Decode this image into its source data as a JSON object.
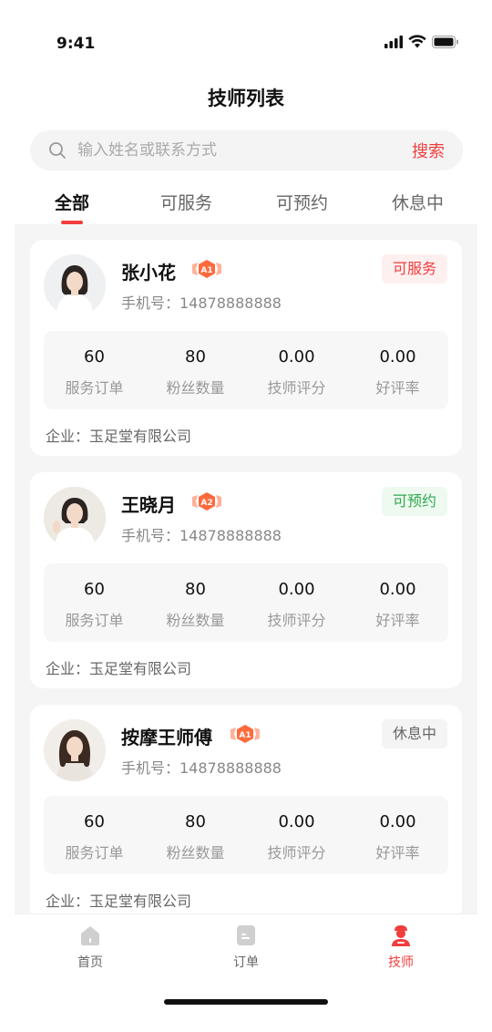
{
  "status_bar": {
    "time": "9:41"
  },
  "header": {
    "title": "技师列表"
  },
  "search": {
    "placeholder": "输入姓名或联系方式",
    "button_label": "搜索"
  },
  "tabs": [
    {
      "label": "全部",
      "active": true
    },
    {
      "label": "可服务",
      "active": false
    },
    {
      "label": "可预约",
      "active": false
    },
    {
      "label": "休息中",
      "active": false
    }
  ],
  "technicians": [
    {
      "name": "张小花",
      "level": "A1",
      "phone": "手机号：14878888888",
      "status": "可服务",
      "status_color": "#f23d3d",
      "status_bg": "#fff0f0",
      "stats": [
        {
          "value": "60",
          "label": "服务订单"
        },
        {
          "value": "80",
          "label": "粉丝数量"
        },
        {
          "value": "0.00",
          "label": "技师评分"
        },
        {
          "value": "0.00",
          "label": "好评率"
        }
      ],
      "company": "企业：玉足堂有限公司"
    },
    {
      "name": "王晓月",
      "level": "A2",
      "phone": "手机号：14878888888",
      "status": "可预约",
      "status_color": "#2fa84f",
      "status_bg": "#eefaf0",
      "stats": [
        {
          "value": "60",
          "label": "服务订单"
        },
        {
          "value": "80",
          "label": "粉丝数量"
        },
        {
          "value": "0.00",
          "label": "技师评分"
        },
        {
          "value": "0.00",
          "label": "好评率"
        }
      ],
      "company": "企业：玉足堂有限公司"
    },
    {
      "name": "按摩王师傅",
      "level": "A1",
      "phone": "手机号：14878888888",
      "status": "休息中",
      "status_color": "#666666",
      "status_bg": "#f4f4f4",
      "stats": [
        {
          "value": "60",
          "label": "服务订单"
        },
        {
          "value": "80",
          "label": "粉丝数量"
        },
        {
          "value": "0.00",
          "label": "技师评分"
        },
        {
          "value": "0.00",
          "label": "好评率"
        }
      ],
      "company": "企业：玉足堂有限公司"
    }
  ],
  "tabbar": [
    {
      "label": "首页",
      "icon": "home-icon",
      "active": false
    },
    {
      "label": "订单",
      "icon": "order-icon",
      "active": false
    },
    {
      "label": "技师",
      "icon": "technician-icon",
      "active": true
    }
  ],
  "colors": {
    "accent": "#f23d3d"
  }
}
